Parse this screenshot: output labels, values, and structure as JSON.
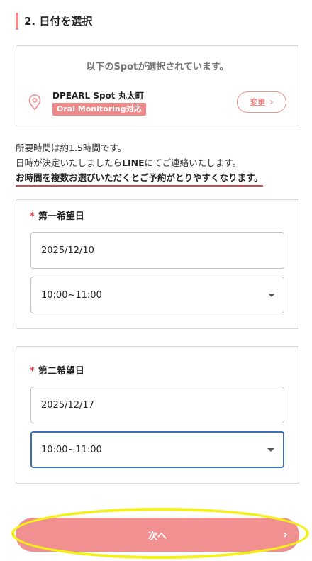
{
  "section": {
    "title": "2. 日付を選択"
  },
  "spot_card": {
    "heading": "以下のSpotが選択されています。",
    "pin_icon": "map-pin-icon",
    "spot_name": "DPEARL Spot 丸太町",
    "badge": "Oral Monitoring対応",
    "change_label": "変更",
    "change_chevron": "›"
  },
  "notes": {
    "line1": "所要時間は約1.5時間です。",
    "line2_before": "日時が決定いたしましたら",
    "line2_link": "LINE",
    "line2_after": "にてご連絡いたします。",
    "line3": "お時間を複数お選びいただくとご予約がとりやすくなります。"
  },
  "first_choice": {
    "required_mark": "*",
    "label": "第一希望日",
    "date": "2025/12/10",
    "time": "10:00~11:00"
  },
  "second_choice": {
    "required_mark": "*",
    "label": "第二希望日",
    "date": "2025/12/17",
    "time": "10:00~11:00"
  },
  "next_button": {
    "label": "次へ",
    "chevron": "›"
  },
  "colors": {
    "accent": "#f09090",
    "badge": "#ee8a8a",
    "required": "#e04848",
    "underline": "#d04848",
    "focus": "#3a70b8",
    "highlight": "#f4f01a"
  }
}
